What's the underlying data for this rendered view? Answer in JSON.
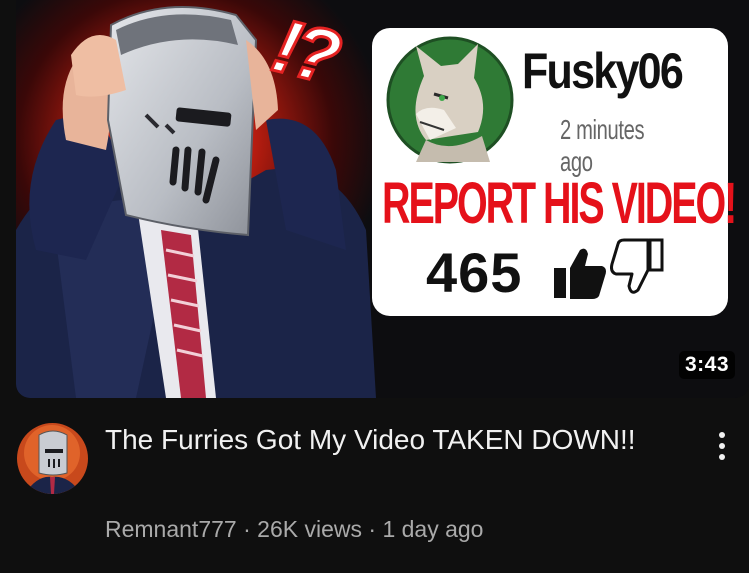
{
  "thumbnail": {
    "duration": "3:43",
    "overlay_text": "!?",
    "card": {
      "username": "Fusky06",
      "time": "2 minutes ago",
      "cta": "REPORT HIS VIDEO!",
      "like_count": "465",
      "like_icon": "thumbs-up-icon",
      "dislike_icon": "thumbs-down-icon"
    }
  },
  "video": {
    "title": "The Furries Got My Video TAKEN DOWN!!",
    "channel": "Remnant777",
    "separator": " · ",
    "views": "26K views",
    "age": "1 day ago",
    "menu_icon": "more-vert-icon"
  },
  "colors": {
    "background": "#0f0f0f",
    "cta_red": "#e5111a",
    "meta_gray": "#aaaaaa"
  }
}
